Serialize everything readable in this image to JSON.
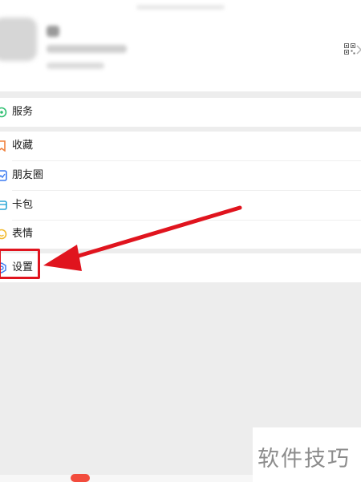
{
  "menu": {
    "services": {
      "label": "服务",
      "icon": "services-icon"
    },
    "favorites": {
      "label": "收藏",
      "icon": "favorites-icon"
    },
    "moments": {
      "label": "朋友圈",
      "icon": "moments-icon"
    },
    "cards": {
      "label": "卡包",
      "icon": "card-wallet-icon"
    },
    "stickers": {
      "label": "表情",
      "icon": "sticker-icon"
    },
    "settings": {
      "label": "设置",
      "icon": "settings-icon"
    }
  },
  "watermark": {
    "text": "软件技巧"
  },
  "colors": {
    "accent_red": "#e0141e",
    "services_green": "#2fbf71",
    "favorites_orange": "#f0803c",
    "moments_blue": "#3d7cf2",
    "cards_teal": "#2aa7d6",
    "stickers_yellow": "#f2b92b",
    "settings_blue": "#3d7cf2"
  }
}
